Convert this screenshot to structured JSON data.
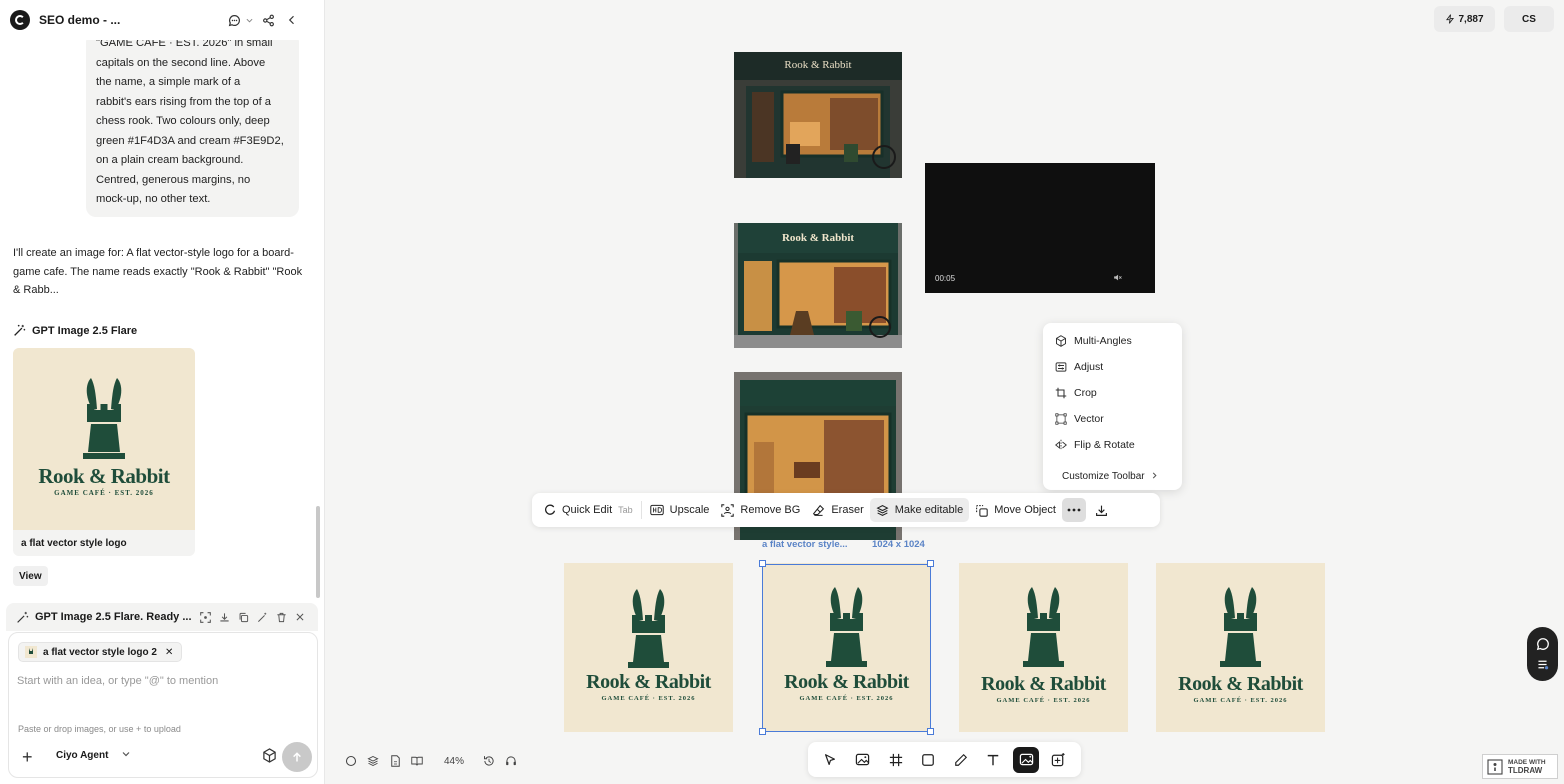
{
  "header": {
    "title": "SEO demo - ..."
  },
  "chat": {
    "user_message_lines": [
      "\"GAME CAFE · EST. 2026\" in small",
      "capitals on the second line. Above",
      "the name, a simple mark of a",
      "rabbit's ears rising from the top of a",
      "chess rook. Two colours only, deep",
      "green #1F4D3A and cream #F3E9D2,",
      "on a plain cream background.",
      "Centred, generous margins, no",
      "mock-up, no other text."
    ],
    "assistant_message": "I'll create an image for: A flat vector-style logo for a board-game cafe. The name reads exactly \"Rook & Rabbit\" \"Rook & Rabb...",
    "model_name": "GPT Image 2.5 Flare",
    "image_caption": "a flat vector style logo",
    "view_label": "View",
    "status_text": "GPT Image 2.5 Flare. Ready ..."
  },
  "composer": {
    "attachment_chip": "a flat vector style logo 2",
    "placeholder": "Start with an idea, or type \"@\" to mention",
    "hint": "Paste or drop images, or use + to upload",
    "agent_label": "Ciyo Agent"
  },
  "top_right": {
    "credits": "7,887",
    "user_initials": "CS"
  },
  "logo": {
    "name": "Rook & Rabbit",
    "tagline": "GAME CAFÉ · EST. 2026",
    "storefront_sign": "Rook & Rabbit"
  },
  "video": {
    "time": "00:05"
  },
  "more_menu": {
    "items": [
      "Multi-Angles",
      "Adjust",
      "Crop",
      "Vector",
      "Flip & Rotate"
    ],
    "customize": "Customize Toolbar"
  },
  "image_toolbar": {
    "quick_edit": "Quick Edit",
    "quick_edit_key": "Tab",
    "upscale": "Upscale",
    "remove_bg": "Remove BG",
    "eraser": "Eraser",
    "make_editable": "Make editable",
    "move_object": "Move Object"
  },
  "selection": {
    "label": "a flat vector style...",
    "size": "1024 x 1024"
  },
  "canvas": {
    "zoom": "44%"
  },
  "watermark": {
    "line1": "MADE WITH",
    "line2": "TLDRAW"
  },
  "colors": {
    "accent": "#4a7bd8",
    "logo_green": "#1F4D3A",
    "logo_cream": "#F3E9D2"
  }
}
